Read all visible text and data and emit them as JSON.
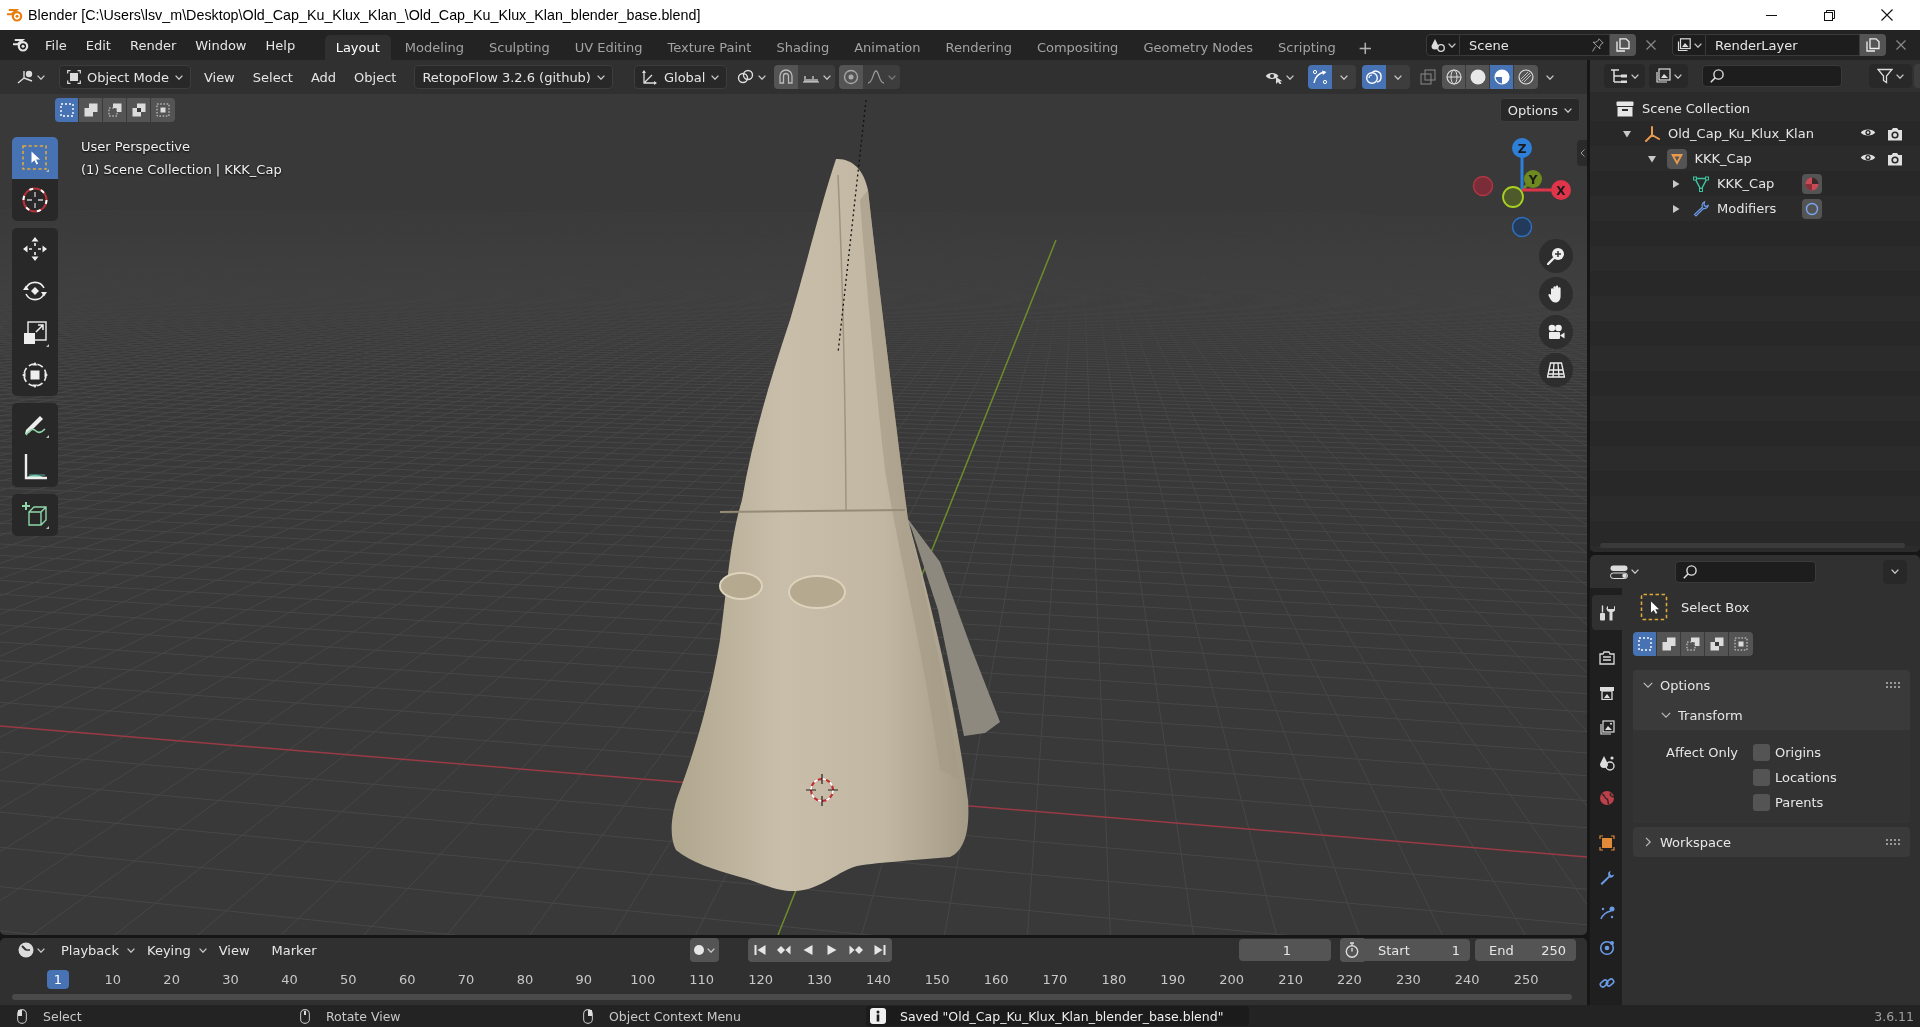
{
  "window": {
    "title": "Blender [C:\\Users\\lsv_m\\Desktop\\Old_Cap_Ku_Klux_Klan_\\Old_Cap_Ku_Klux_Klan_blender_base.blend]"
  },
  "topbar": {
    "menus": [
      "File",
      "Edit",
      "Render",
      "Window",
      "Help"
    ],
    "workspaces": [
      {
        "label": "Layout",
        "selected": true
      },
      {
        "label": "Modeling",
        "selected": false
      },
      {
        "label": "Sculpting",
        "selected": false
      },
      {
        "label": "UV Editing",
        "selected": false
      },
      {
        "label": "Texture Paint",
        "selected": false
      },
      {
        "label": "Shading",
        "selected": false
      },
      {
        "label": "Animation",
        "selected": false
      },
      {
        "label": "Rendering",
        "selected": false
      },
      {
        "label": "Compositing",
        "selected": false
      },
      {
        "label": "Geometry Nodes",
        "selected": false
      },
      {
        "label": "Scripting",
        "selected": false
      }
    ],
    "add_workspace": "+",
    "scene": "Scene",
    "view_layer": "RenderLayer"
  },
  "viewport": {
    "mode": "Object Mode",
    "menus": [
      "View",
      "Select",
      "Add",
      "Object"
    ],
    "addon_menu": "RetopoFlow 3.2.6 (github)",
    "orientation": "Global",
    "toggles": [
      {
        "kind": "gizmos",
        "on": true
      },
      {
        "kind": "overlays",
        "on": true
      },
      {
        "kind": "xray",
        "on": false
      }
    ],
    "shading": [
      {
        "kind": "wireframe",
        "selected": false
      },
      {
        "kind": "solid",
        "selected": false
      },
      {
        "kind": "material",
        "selected": true
      },
      {
        "kind": "rendered",
        "selected": false
      }
    ],
    "select_modes": [
      {
        "kind": "new",
        "selected": true
      },
      {
        "kind": "extend",
        "selected": false
      },
      {
        "kind": "subtract",
        "selected": false
      },
      {
        "kind": "invert",
        "selected": false
      },
      {
        "kind": "intersect",
        "selected": false
      }
    ],
    "options": "Options",
    "tool_groups": [
      {
        "tools": [
          {
            "kind": "select",
            "selected": true
          },
          {
            "kind": "cursor",
            "selected": false
          }
        ]
      },
      {
        "tools": [
          {
            "kind": "move",
            "selected": false
          },
          {
            "kind": "rotate",
            "selected": false
          },
          {
            "kind": "scale",
            "selected": false
          },
          {
            "kind": "transform",
            "selected": false
          }
        ]
      },
      {
        "tools": [
          {
            "kind": "annotate",
            "selected": false
          },
          {
            "kind": "measure",
            "selected": false
          }
        ]
      },
      {
        "tools": [
          {
            "kind": "add",
            "selected": false
          }
        ]
      }
    ],
    "overlay_text": [
      "User Perspective",
      "(1) Scene Collection | KKK_Cap"
    ],
    "axes": {
      "z": "Z",
      "y": "Y",
      "x": "X"
    }
  },
  "outliner": {
    "root": "Scene Collection",
    "items": [
      {
        "label": "Old_Cap_Ku_Klux_Klan",
        "kind": "empty",
        "expanded": true,
        "children": [
          {
            "label": "KKK_Cap",
            "kind": "object",
            "expanded": true,
            "children": [
              {
                "label": "KKK_Cap",
                "kind": "mesh",
                "expanded": false
              },
              {
                "label": "Modifiers",
                "kind": "modifiers",
                "expanded": false
              }
            ]
          }
        ]
      }
    ]
  },
  "properties": {
    "tab_groups": [
      {
        "tabs": [
          {
            "kind": "tool",
            "selected": true
          }
        ]
      },
      {
        "tabs": [
          {
            "kind": "render",
            "selected": false
          },
          {
            "kind": "output",
            "selected": false
          },
          {
            "kind": "view_layer",
            "selected": false
          },
          {
            "kind": "scene",
            "selected": false
          },
          {
            "kind": "world",
            "selected": false
          }
        ]
      },
      {
        "tabs": [
          {
            "kind": "object",
            "selected": false
          },
          {
            "kind": "modifiers",
            "selected": false
          },
          {
            "kind": "particles",
            "selected": false
          },
          {
            "kind": "physics",
            "selected": false
          },
          {
            "kind": "constraints",
            "selected": false
          }
        ]
      }
    ],
    "tool": "Select Box",
    "select_modes": [
      {
        "kind": "new",
        "selected": true
      },
      {
        "kind": "extend",
        "selected": false
      },
      {
        "kind": "subtract",
        "selected": false
      },
      {
        "kind": "invert",
        "selected": false
      },
      {
        "kind": "intersect",
        "selected": false
      }
    ],
    "panels": [
      {
        "title": "Options",
        "expanded": true,
        "subpanels": [
          {
            "title": "Transform",
            "expanded": true,
            "label": "Affect Only",
            "options": [
              {
                "label": "Origins",
                "checked": false
              },
              {
                "label": "Locations",
                "checked": false
              },
              {
                "label": "Parents",
                "checked": false
              }
            ]
          }
        ]
      },
      {
        "title": "Workspace",
        "expanded": false
      }
    ]
  },
  "timeline": {
    "menus": [
      {
        "label": "Playback",
        "dropdown": true
      },
      {
        "label": "Keying",
        "dropdown": true
      },
      {
        "label": "View",
        "dropdown": false
      },
      {
        "label": "Marker",
        "dropdown": false
      }
    ],
    "current_frame": "1",
    "start_label": "Start",
    "start": "1",
    "end_label": "End",
    "end": "250",
    "frames": [
      {
        "label": "1",
        "selected": true
      },
      {
        "label": "10",
        "selected": false
      },
      {
        "label": "20",
        "selected": false
      },
      {
        "label": "30",
        "selected": false
      },
      {
        "label": "40",
        "selected": false
      },
      {
        "label": "50",
        "selected": false
      },
      {
        "label": "60",
        "selected": false
      },
      {
        "label": "70",
        "selected": false
      },
      {
        "label": "80",
        "selected": false
      },
      {
        "label": "90",
        "selected": false
      },
      {
        "label": "100",
        "selected": false
      },
      {
        "label": "110",
        "selected": false
      },
      {
        "label": "120",
        "selected": false
      },
      {
        "label": "130",
        "selected": false
      },
      {
        "label": "140",
        "selected": false
      },
      {
        "label": "150",
        "selected": false
      },
      {
        "label": "160",
        "selected": false
      },
      {
        "label": "170",
        "selected": false
      },
      {
        "label": "180",
        "selected": false
      },
      {
        "label": "190",
        "selected": false
      },
      {
        "label": "200",
        "selected": false
      },
      {
        "label": "210",
        "selected": false
      },
      {
        "label": "220",
        "selected": false
      },
      {
        "label": "230",
        "selected": false
      },
      {
        "label": "240",
        "selected": false
      },
      {
        "label": "250",
        "selected": false
      }
    ]
  },
  "status_bar": {
    "hints": [
      {
        "kind": "left",
        "label": "Select"
      },
      {
        "kind": "middle",
        "label": "Rotate View"
      },
      {
        "kind": "right",
        "label": "Object Context Menu"
      }
    ],
    "message": "Saved \"Old_Cap_Ku_Klux_Klan_blender_base.blend\"",
    "version": "3.6.11"
  }
}
